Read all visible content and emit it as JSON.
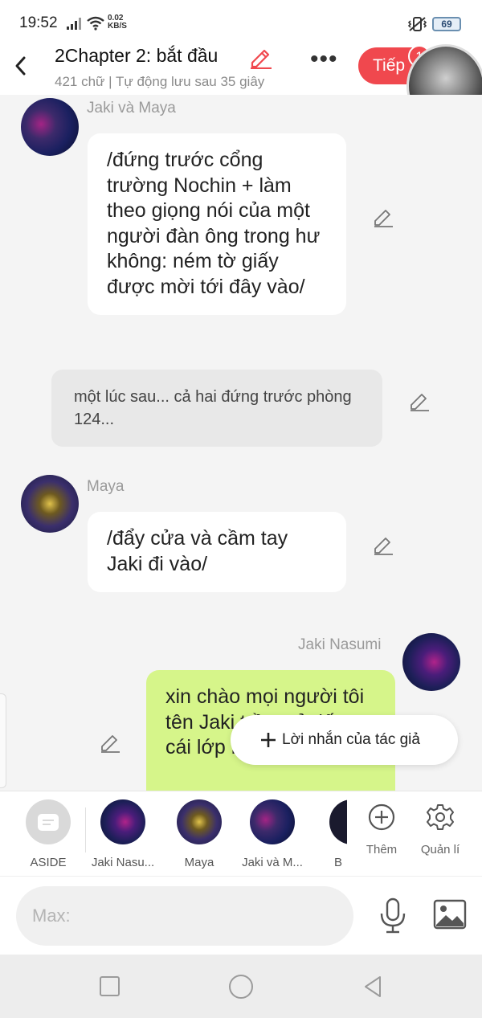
{
  "status_bar": {
    "time": "19:52",
    "net_speed_value": "0.02",
    "net_speed_unit": "KB/S",
    "battery": "69"
  },
  "header": {
    "title": "2Chapter 2: bắt đầu",
    "subtitle": "421 chữ | Tự động lưu sau 35 giây",
    "more_label": "•••",
    "next_label": "Tiếp",
    "notification_count": "1"
  },
  "messages": [
    {
      "sender": "Jaki và Maya",
      "avatar": "jaki-and-maya",
      "text": "/đứng trước cổng trường Nochin + làm theo giọng nói của một người đàn ông trong hư không: ném tờ giấy được mời tới đây vào/"
    },
    {
      "type": "narration",
      "text": "một lúc sau... cả hai đứng trước phòng 124..."
    },
    {
      "sender": "Maya",
      "avatar": "maya",
      "text": "/đẩy cửa và cầm tay Jaki đi vào/"
    },
    {
      "sender": "Jaki Nasumi",
      "avatar": "jaki",
      "side": "right",
      "text": "xin chào mọi người tôi tên Jaki trầm cả tiếp cái lớp học ma"
    }
  ],
  "author_note_label": "Lời nhắn của tác giả",
  "characters": [
    {
      "name": "ASIDE",
      "avatar": "aside"
    },
    {
      "name": "Jaki Nasu...",
      "avatar": "jaki"
    },
    {
      "name": "Maya",
      "avatar": "maya"
    },
    {
      "name": "Jaki và M...",
      "avatar": "jaki-and-maya"
    },
    {
      "name": "B",
      "avatar": "partial"
    }
  ],
  "actions": {
    "add_label": "Thêm",
    "manage_label": "Quản lí"
  },
  "input": {
    "placeholder": "Max:"
  },
  "colors": {
    "accent_red": "#f0484e",
    "own_bubble": "#d6f58a",
    "narration_bg": "#e8e8e8"
  }
}
